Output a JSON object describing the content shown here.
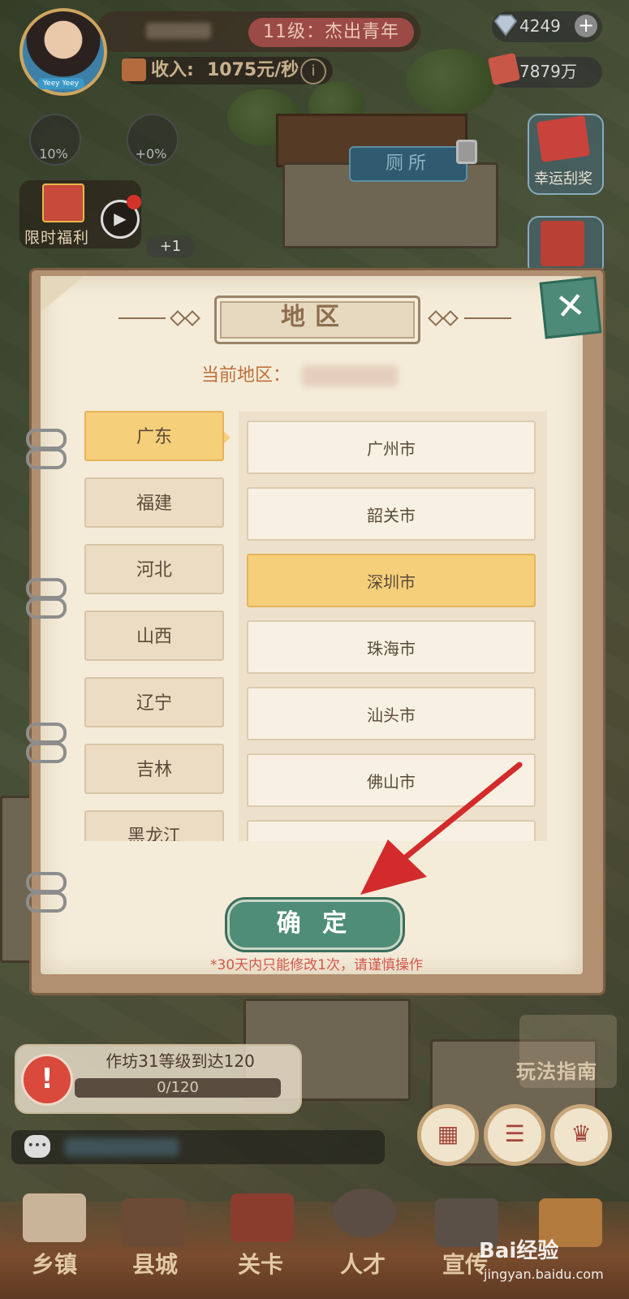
{
  "hud": {
    "level_title": "11级：杰出青年",
    "income_label": "收入:",
    "income_value": "1075元/秒",
    "info_symbol": "i",
    "gems": "4249",
    "plus_symbol": "+",
    "cash": "7879万",
    "boost_1": "10%",
    "boost_2": "+0%",
    "gift_label": "限时福利",
    "toilet_label": "厕所",
    "lucky_label": "幸运刮奖",
    "plus_one": "+1",
    "avatar_tag": "Yeey Yeey"
  },
  "modal": {
    "title": "地区",
    "close_symbol": "✕",
    "current_region_label": "当前地区：",
    "provinces": [
      "广东",
      "福建",
      "河北",
      "山西",
      "辽宁",
      "吉林",
      "黑龙江"
    ],
    "selected_province_index": 0,
    "cities": [
      "广州市",
      "韶关市",
      "深圳市",
      "珠海市",
      "汕头市",
      "佛山市",
      ""
    ],
    "selected_city_index": 2,
    "confirm_label": "确 定",
    "notice": "*30天内只能修改1次，请谨慎操作"
  },
  "task": {
    "alert_symbol": "!",
    "text": "作坊31等级到达120",
    "progress_text": "0/120",
    "progress_fraction": 0.0
  },
  "guide_label": "玩法指南",
  "nav": {
    "tabs": [
      "乡镇",
      "县城",
      "关卡",
      "人才",
      "宣传"
    ]
  },
  "watermark": {
    "brand": "Bai经验",
    "url": "jingyan.baidu.com"
  },
  "colors": {
    "accent_selected": "#f5cf7a",
    "confirm_green": "#4f8d78",
    "notice_red": "#d3574d",
    "arrow_red": "#d32b2b"
  }
}
